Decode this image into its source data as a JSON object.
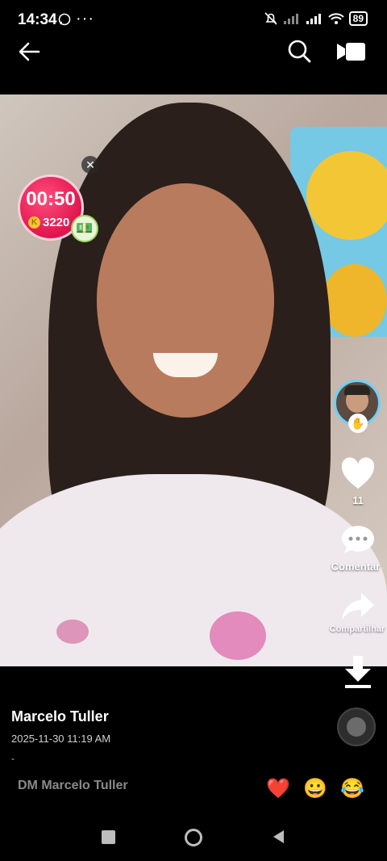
{
  "status_bar": {
    "time": "14:34",
    "notif_app_icon": "whatsapp-icon",
    "more_dots": "···",
    "battery": "89"
  },
  "top_nav": {
    "back_icon": "back-arrow-icon",
    "search_icon": "search-icon",
    "camera_icon": "video-camera-icon"
  },
  "timer_badge": {
    "time": "00:50",
    "coins": "3220",
    "coin_symbol": "K"
  },
  "rail": {
    "likes": "11",
    "comment_label": "Comentar",
    "share_label": "Compartilhar"
  },
  "post": {
    "username": "Marcelo Tuller",
    "datetime": "2025-11-30 11:19 AM",
    "caption": "-"
  },
  "dm": {
    "placeholder": "DM Marcelo Tuller",
    "quick_reactions": [
      "❤️",
      "😀",
      "😂"
    ]
  },
  "colors": {
    "timer_badge": "#e0154e",
    "avatar_ring": "#6ad1ff"
  }
}
